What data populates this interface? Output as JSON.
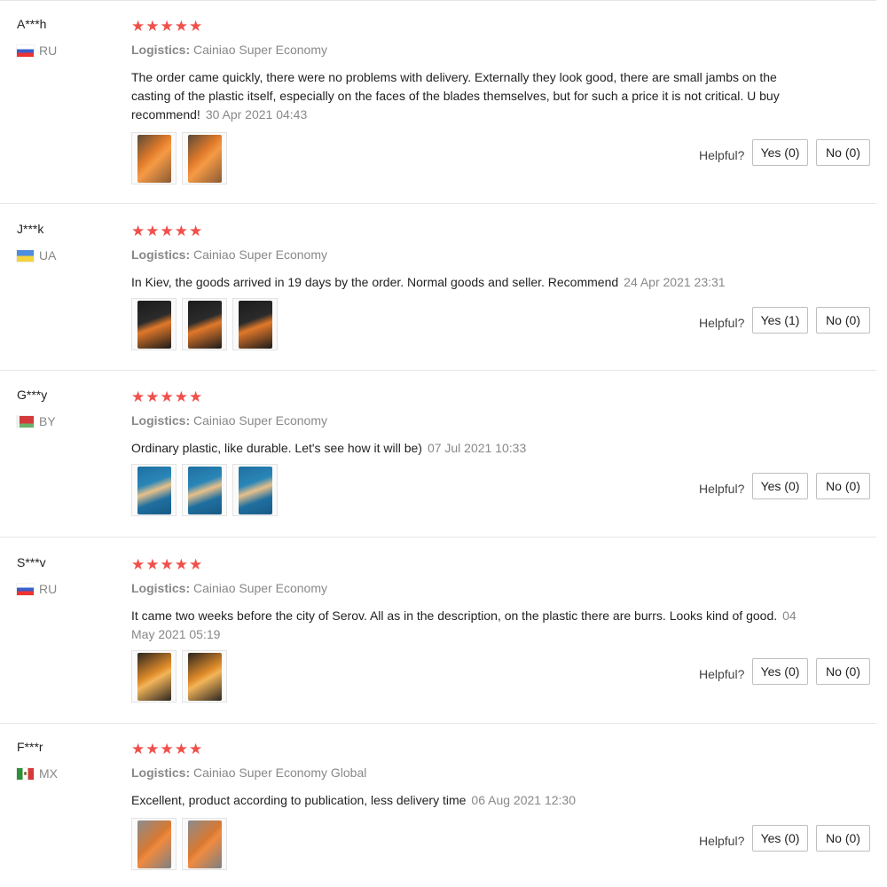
{
  "helpful_label": "Helpful?",
  "reviews": [
    {
      "user": "A***h",
      "country": "RU",
      "flag": "ru",
      "stars": "★★★★★",
      "logistics_label": "Logistics:",
      "logistics_value": "Cainiao Super Economy",
      "text": "The order came quickly, there were no problems with delivery. Externally they look good, there are small jambs on the casting of the plastic itself, especially on the faces of the blades themselves, but for such a price it is not critical. U buy recommend!",
      "date": "30 Apr 2021 04:43",
      "images": [
        "t-orange",
        "t-orange"
      ],
      "yes": "Yes (0)",
      "no": "No (0)"
    },
    {
      "user": "J***k",
      "country": "UA",
      "flag": "ua",
      "stars": "★★★★★",
      "logistics_label": "Logistics:",
      "logistics_value": "Cainiao Super Economy",
      "text": "In Kiev, the goods arrived in 19 days by the order. Normal goods and seller. Recommend",
      "date": "24 Apr 2021 23:31",
      "images": [
        "t-dark",
        "t-dark",
        "t-dark"
      ],
      "yes": "Yes (1)",
      "no": "No (0)"
    },
    {
      "user": "G***y",
      "country": "BY",
      "flag": "by",
      "stars": "★★★★★",
      "logistics_label": "Logistics:",
      "logistics_value": "Cainiao Super Economy",
      "text": "Ordinary plastic, like durable. Let's see how it will be)",
      "date": "07 Jul 2021 10:33",
      "images": [
        "t-blue",
        "t-blue",
        "t-blue"
      ],
      "yes": "Yes (0)",
      "no": "No (0)"
    },
    {
      "user": "S***v",
      "country": "RU",
      "flag": "ru",
      "stars": "★★★★★",
      "logistics_label": "Logistics:",
      "logistics_value": "Cainiao Super Economy",
      "text": "It came two weeks before the city of Serov. All as in the description, on the plastic there are burrs. Looks kind of good.",
      "date": "04 May 2021 05:19",
      "images": [
        "t-fire",
        "t-fire"
      ],
      "yes": "Yes (0)",
      "no": "No (0)"
    },
    {
      "user": "F***r",
      "country": "MX",
      "flag": "mx",
      "stars": "★★★★★",
      "logistics_label": "Logistics:",
      "logistics_value": "Cainiao Super Economy Global",
      "text": "Excellent, product according to publication, less delivery time",
      "date": "06 Aug 2021 12:30",
      "images": [
        "t-gray",
        "t-gray"
      ],
      "yes": "Yes (0)",
      "no": "No (0)"
    }
  ]
}
